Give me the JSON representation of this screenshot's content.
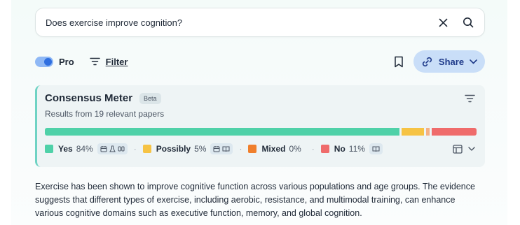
{
  "search": {
    "query": "Does exercise improve cognition?"
  },
  "toolbar": {
    "pro_label": "Pro",
    "filter_label": "Filter",
    "share_label": "Share",
    "pro_enabled": true
  },
  "meter": {
    "title": "Consensus Meter",
    "badge": "Beta",
    "subtitle": "Results from 19 relevant papers",
    "segments": [
      {
        "name": "Yes",
        "percent": 84,
        "color": "#4fd1a8"
      },
      {
        "name": "Possibly",
        "percent": 5,
        "color": "#f6c344"
      },
      {
        "name": "Mixed",
        "percent": 0,
        "color": "#f5b184"
      },
      {
        "name": "No",
        "percent": 11,
        "color": "#ef6b6b"
      }
    ],
    "legend": {
      "yes": {
        "name": "Yes",
        "pct": "84%"
      },
      "possibly": {
        "name": "Possibly",
        "pct": "5%"
      },
      "mixed": {
        "name": "Mixed",
        "pct": "0%"
      },
      "no": {
        "name": "No",
        "pct": "11%"
      }
    }
  },
  "summary": "Exercise has been shown to improve cognitive function across various populations and age groups. The evidence suggests that different types of exercise, including aerobic, resistance, and multimodal training, can enhance various cognitive domains such as executive function, memory, and global cognition.",
  "colors": {
    "accent": "#2f6fe0",
    "share_bg": "#c9def8",
    "meter_border": "#6fd3c4"
  }
}
